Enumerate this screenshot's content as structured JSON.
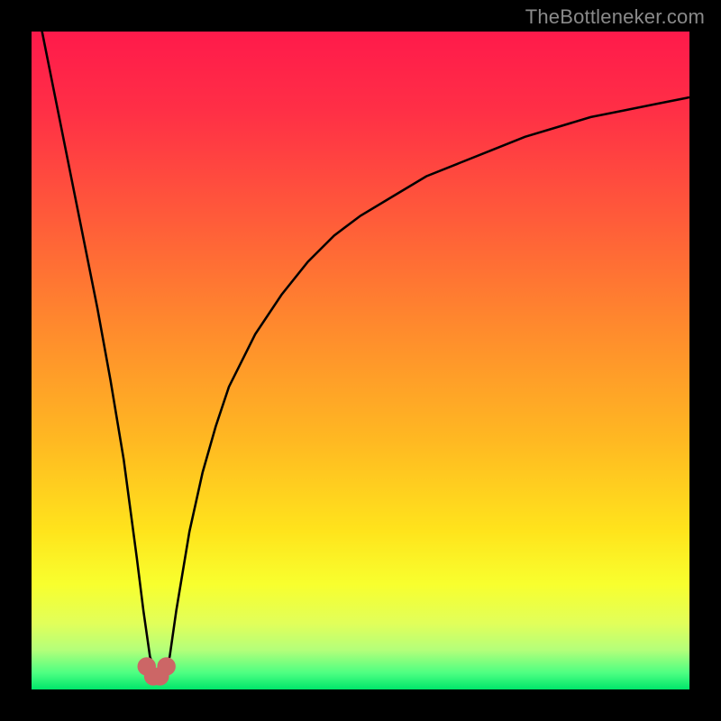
{
  "watermark": "TheBottleneker.com",
  "colors": {
    "frame": "#000000",
    "curve": "#000000",
    "marker": "#cc6666",
    "gradient_stops": [
      {
        "offset": 0.0,
        "color": "#ff1a4b"
      },
      {
        "offset": 0.12,
        "color": "#ff2f46"
      },
      {
        "offset": 0.28,
        "color": "#ff5a3a"
      },
      {
        "offset": 0.45,
        "color": "#ff8a2d"
      },
      {
        "offset": 0.62,
        "color": "#ffb822"
      },
      {
        "offset": 0.76,
        "color": "#ffe41c"
      },
      {
        "offset": 0.84,
        "color": "#f8ff2e"
      },
      {
        "offset": 0.9,
        "color": "#e1ff5a"
      },
      {
        "offset": 0.94,
        "color": "#b4ff7a"
      },
      {
        "offset": 0.975,
        "color": "#4dff82"
      },
      {
        "offset": 1.0,
        "color": "#00e66a"
      }
    ]
  },
  "chart_data": {
    "type": "line",
    "title": "",
    "xlabel": "",
    "ylabel": "",
    "xlim": [
      0,
      100
    ],
    "ylim": [
      0,
      100
    ],
    "x_min_at": 19,
    "series": [
      {
        "name": "bottleneck-curve",
        "x": [
          0,
          2,
          4,
          6,
          8,
          10,
          12,
          14,
          16,
          17,
          18,
          19,
          20,
          21,
          22,
          24,
          26,
          28,
          30,
          34,
          38,
          42,
          46,
          50,
          55,
          60,
          65,
          70,
          75,
          80,
          85,
          90,
          95,
          100
        ],
        "values": [
          108,
          98,
          88,
          78,
          68,
          58,
          47,
          35,
          20,
          12,
          5,
          2,
          2,
          5,
          12,
          24,
          33,
          40,
          46,
          54,
          60,
          65,
          69,
          72,
          75,
          78,
          80,
          82,
          84,
          85.5,
          87,
          88,
          89,
          90
        ]
      }
    ],
    "markers": {
      "name": "minimum-markers",
      "x": [
        17.5,
        18.5,
        19.5,
        20.5
      ],
      "values": [
        3.5,
        2.0,
        2.0,
        3.5
      ],
      "radius": 1.4
    }
  }
}
